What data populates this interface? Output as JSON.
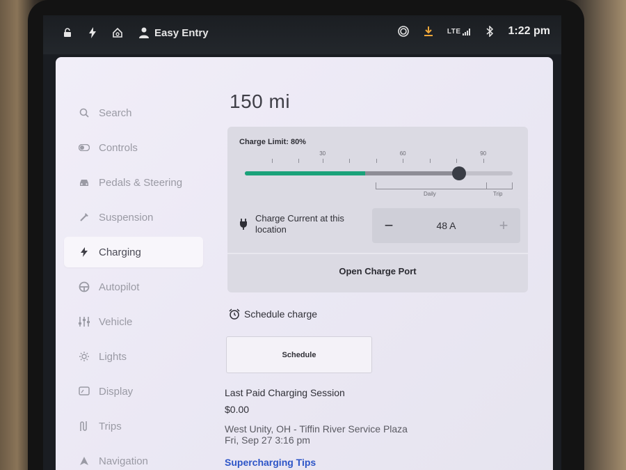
{
  "status_bar": {
    "user_label": "Easy Entry",
    "network": "LTE",
    "time": "1:22 pm"
  },
  "sidebar": {
    "items": [
      {
        "label": "Search",
        "icon": "search-icon",
        "active": false
      },
      {
        "label": "Controls",
        "icon": "toggle-icon",
        "active": false
      },
      {
        "label": "Pedals & Steering",
        "icon": "car-icon",
        "active": false
      },
      {
        "label": "Suspension",
        "icon": "wrench-icon",
        "active": false
      },
      {
        "label": "Charging",
        "icon": "bolt-icon",
        "active": true
      },
      {
        "label": "Autopilot",
        "icon": "steering-wheel-icon",
        "active": false
      },
      {
        "label": "Vehicle",
        "icon": "sliders-icon",
        "active": false
      },
      {
        "label": "Lights",
        "icon": "sun-icon",
        "active": false
      },
      {
        "label": "Display",
        "icon": "display-icon",
        "active": false
      },
      {
        "label": "Trips",
        "icon": "trip-icon",
        "active": false
      },
      {
        "label": "Navigation",
        "icon": "navigation-arrow-icon",
        "active": false
      }
    ]
  },
  "main": {
    "range": "150 mi",
    "charge_limit_label": "Charge Limit: 80%",
    "charge_limit_percent": 80,
    "current_charge_percent": 45,
    "tick_labels": [
      "30",
      "60",
      "90"
    ],
    "daily_label": "Daily",
    "trip_label": "Trip",
    "charge_current_label": "Charge Current at this location",
    "charge_current_value": "48 A",
    "decrement_symbol": "−",
    "increment_symbol": "+",
    "open_port_label": "Open Charge Port",
    "schedule_header": "Schedule charge",
    "schedule_button": "Schedule",
    "last_session_title": "Last Paid Charging Session",
    "last_session_amount": "$0.00",
    "last_session_location": "West Unity, OH - Tiffin River Service Plaza",
    "last_session_date": "Fri, Sep 27 3:16 pm",
    "tips_link": "Supercharging Tips"
  },
  "colors": {
    "accent_green": "#1aa27a",
    "link_blue": "#2d55c7",
    "panel_bg": "#ebe8f4"
  }
}
